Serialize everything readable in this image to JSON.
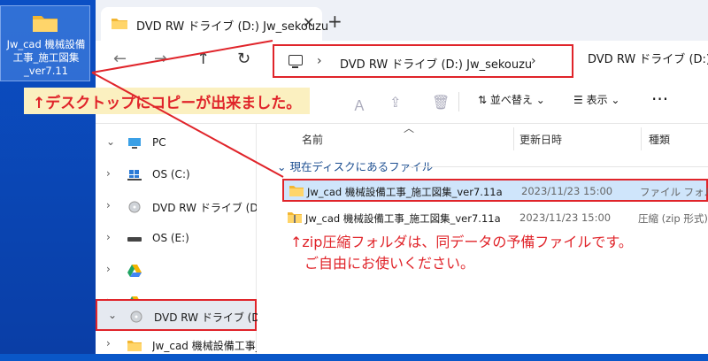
{
  "desktop": {
    "icon_label": "Jw_cad 機械設備\n工事_施工図集\n_ver7.11"
  },
  "window": {
    "tab_title": "DVD RW ドライブ (D:) Jw_sekouzu",
    "tab_close": "✕",
    "new_tab": "+",
    "nav_back": "←",
    "nav_forward": "→",
    "nav_up": "↑",
    "nav_refresh": "↻",
    "breadcrumb": "DVD RW ドライブ (D:) Jw_sekouzu",
    "breadcrumb_sep": "›",
    "breadcrumb_ghost": "DVD RW ドライブ (D:)"
  },
  "toolbar": {
    "sort_label": "並べ替え",
    "view_label": "表示",
    "more": "···"
  },
  "sidebar": {
    "items": [
      {
        "label": "PC",
        "icon": "pc-icon",
        "arrow": "⌄"
      },
      {
        "label": "OS (C:)",
        "icon": "drive-icon",
        "arrow": "›"
      },
      {
        "label": "DVD RW ドライブ (D:) Jw",
        "icon": "disc-icon",
        "arrow": "›"
      },
      {
        "label": "OS (E:)",
        "icon": "drive-icon",
        "arrow": "›"
      },
      {
        "label": "",
        "icon": "google-drive-icon",
        "arrow": "›"
      },
      {
        "label": "",
        "icon": "google-drive-icon",
        "arrow": "›"
      },
      {
        "label": "DVD RW ドライブ (D:) Jw_",
        "icon": "disc-icon",
        "arrow": "⌄"
      },
      {
        "label": "Jw_cad 機械設備工事_",
        "icon": "folder-icon",
        "arrow": "›"
      }
    ]
  },
  "content": {
    "columns": [
      "名前",
      "更新日時",
      "種類"
    ],
    "group_header": "現在ディスクにあるファイル",
    "rows": [
      {
        "name": "Jw_cad 機械設備工事_施工図集_ver7.11a",
        "date": "2023/11/23 15:00",
        "type": "ファイル フォルダー"
      },
      {
        "name": "Jw_cad 機械設備工事_施工図集_ver7.11a",
        "date": "2023/11/23 15:00",
        "type": "圧縮 (zip 形式)"
      }
    ]
  },
  "annotations": {
    "copy_note": "↑デスクトップにコピーが出来ました。",
    "zip_note_line1": "↑zip圧縮フォルダは、同データの予備ファイルです。",
    "zip_note_line2": "ご自由にお使いください。",
    "color": "#e0242a"
  },
  "colors": {
    "desktop_bg": "#0a57c8",
    "selection": "#cfe5fb",
    "highlight_border": "#e0242a",
    "folder": "#f5c542"
  }
}
